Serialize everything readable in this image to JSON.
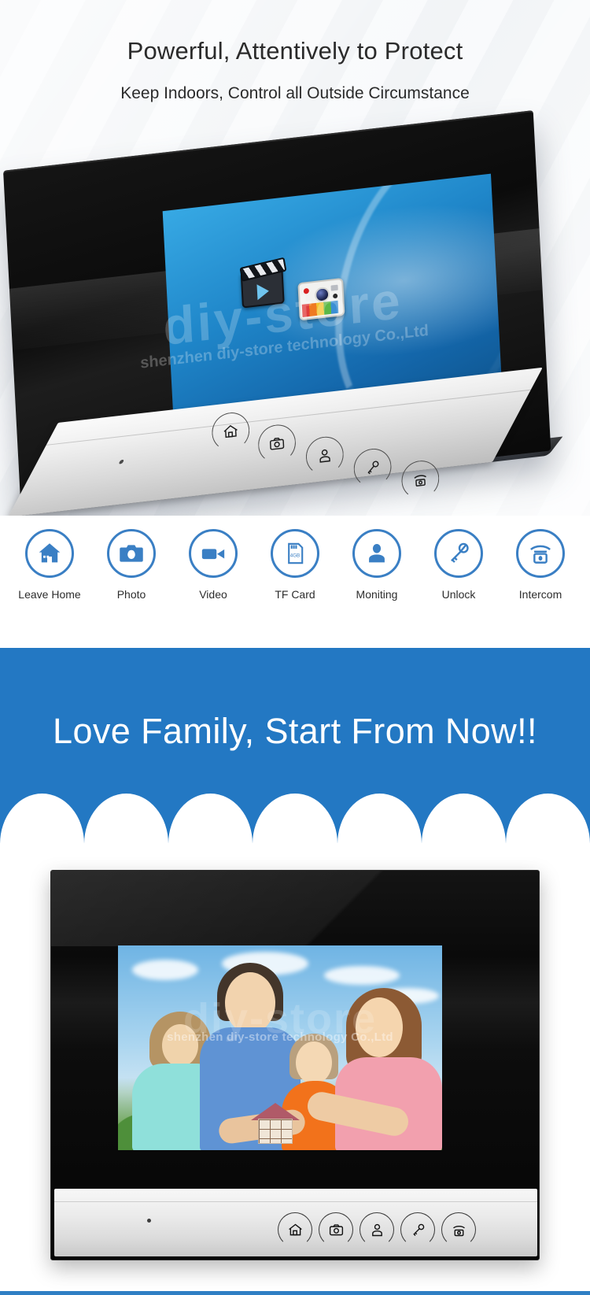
{
  "hero": {
    "title": "Powerful, Attentively to Protect",
    "subtitle": "Keep Indoors, Control all Outside Circumstance"
  },
  "watermark": {
    "brand": "diy-store",
    "company": "shenzhen diy-store technology Co.,Ltd"
  },
  "top_device": {
    "name": "video-door-phone-monitor",
    "screen_icons": [
      "video-clapper-icon",
      "camera-icon"
    ],
    "touch_buttons": [
      {
        "icon": "home-icon",
        "name": "leave-home-button"
      },
      {
        "icon": "camera-icon",
        "name": "photo-button"
      },
      {
        "icon": "person-icon",
        "name": "monitor-button"
      },
      {
        "icon": "keys-icon",
        "name": "unlock-button"
      },
      {
        "icon": "intercom-icon",
        "name": "intercom-button"
      }
    ]
  },
  "features": [
    {
      "label": "Leave Home",
      "icon": "home-icon"
    },
    {
      "label": "Photo",
      "icon": "camera-icon"
    },
    {
      "label": "Video",
      "icon": "video-camera-icon"
    },
    {
      "label": "TF Card",
      "icon": "tf-card-icon",
      "card_text": "4GB"
    },
    {
      "label": "Moniting",
      "icon": "person-icon"
    },
    {
      "label": "Unlock",
      "icon": "keys-icon"
    },
    {
      "label": "Intercom",
      "icon": "intercom-icon"
    }
  ],
  "banner": {
    "text": "Love Family, Start From Now!!",
    "color": "#2378c3"
  },
  "bottom_device": {
    "name": "video-door-phone-monitor-family",
    "screen_content": "family-photo-holding-house-model",
    "touch_buttons": [
      {
        "icon": "home-icon",
        "name": "leave-home-button"
      },
      {
        "icon": "camera-icon",
        "name": "photo-button"
      },
      {
        "icon": "person-icon",
        "name": "monitor-button"
      },
      {
        "icon": "keys-icon",
        "name": "unlock-button"
      },
      {
        "icon": "intercom-icon",
        "name": "intercom-button"
      }
    ]
  },
  "colors": {
    "accent_blue": "#3a7fc4",
    "banner_blue": "#2378c3",
    "text_dark": "#2b2b2b"
  }
}
